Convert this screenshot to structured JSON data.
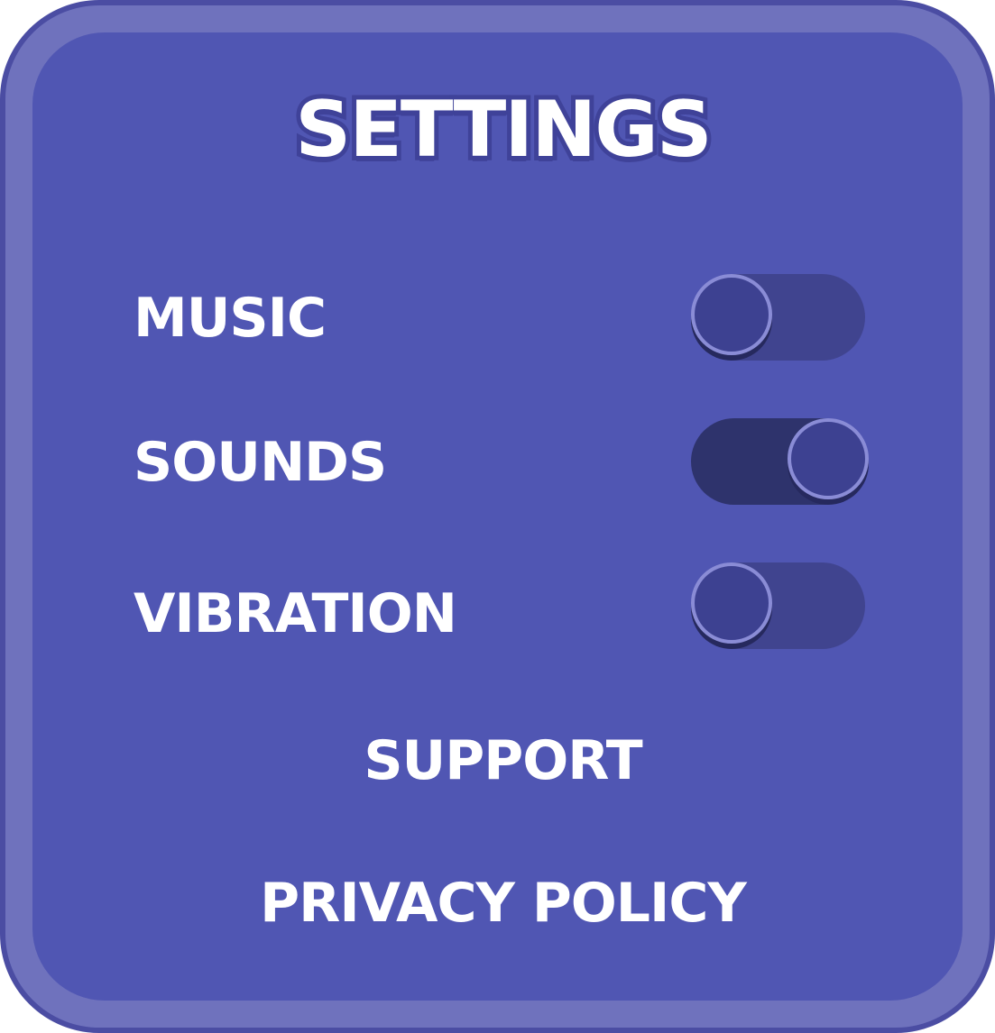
{
  "title": "SETTINGS",
  "settings": [
    {
      "label": "MUSIC",
      "state": "off"
    },
    {
      "label": "SOUNDS",
      "state": "on"
    },
    {
      "label": "VIBRATION",
      "state": "off"
    }
  ],
  "links": {
    "support": "SUPPORT",
    "privacy_policy": "PRIVACY POLICY"
  },
  "colors": {
    "panel_border": "#6f72bd",
    "panel_fill": "#5056b3",
    "toggle_on_track": "#2e336c",
    "toggle_off_track": "#40448f",
    "knob_ring": "#8a8cd6",
    "text": "#ffffff"
  }
}
